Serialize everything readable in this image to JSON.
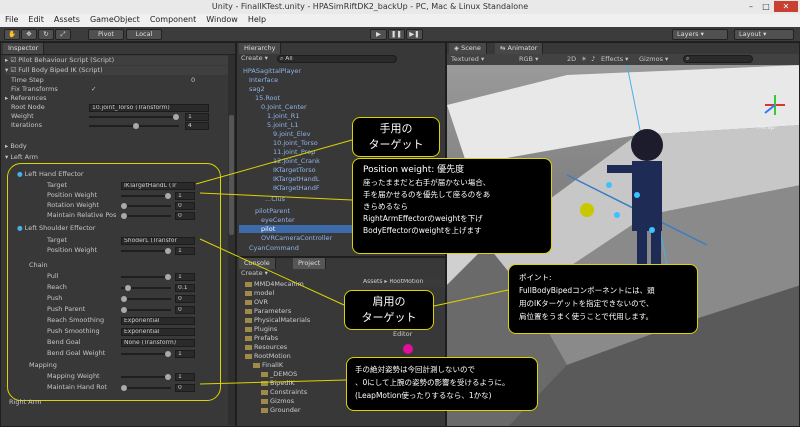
{
  "window": {
    "title": "Unity - FinalIKTest.unity - HPASimRiftDK2_backUp - PC, Mac & Linux Standalone"
  },
  "menu": [
    "File",
    "Edit",
    "Assets",
    "GameObject",
    "Component",
    "Window",
    "Help"
  ],
  "toolbar": {
    "pivot": "Pivot",
    "local": "Local",
    "layers": "Layers",
    "layout": "Layout"
  },
  "inspector": {
    "tab": "Inspector",
    "components": [
      "Pilot Behaviour Script (Script)",
      "Full Body Biped IK (Script)"
    ],
    "rows": [
      {
        "label": "Time Step",
        "value": "0"
      },
      {
        "label": "Fix Transforms",
        "value": "✓"
      },
      {
        "label": "References",
        "value": ""
      },
      {
        "label": "Root Node",
        "value": "10.joint_Torso (Transform)"
      },
      {
        "label": "Weight",
        "value": "1"
      },
      {
        "label": "Iterations",
        "value": "4"
      },
      {
        "label": "Body",
        "value": ""
      },
      {
        "label": "Left Arm",
        "value": ""
      }
    ],
    "left_hand_effector": {
      "title": "Left Hand Effector",
      "rows": [
        {
          "label": "Target",
          "value": "IKTargetHandL (Tr"
        },
        {
          "label": "Position Weight",
          "value": "1"
        },
        {
          "label": "Rotation Weight",
          "value": "0"
        },
        {
          "label": "Maintain Relative Pos",
          "value": "0"
        }
      ]
    },
    "left_shoulder_effector": {
      "title": "Left Shoulder Effector",
      "rows": [
        {
          "label": "Target",
          "value": "ShoderL (Transfor"
        },
        {
          "label": "Position Weight",
          "value": "1"
        }
      ]
    },
    "chain": {
      "title": "Chain",
      "rows": [
        {
          "label": "Pull",
          "value": "1"
        },
        {
          "label": "Reach",
          "value": "0.1"
        },
        {
          "label": "Push",
          "value": "0"
        },
        {
          "label": "Push Parent",
          "value": "0"
        },
        {
          "label": "Reach Smoothing",
          "value": "Exponential"
        },
        {
          "label": "Push Smoothing",
          "value": "Exponential"
        },
        {
          "label": "Bend Goal",
          "value": "None (Transform)"
        },
        {
          "label": "Bend Goal Weight",
          "value": "1"
        }
      ]
    },
    "mapping": {
      "title": "Mapping",
      "rows": [
        {
          "label": "Mapping Weight",
          "value": "1"
        },
        {
          "label": "Maintain Hand Rot",
          "value": "0"
        }
      ]
    },
    "right_arm": "Right Arm"
  },
  "hierarchy": {
    "tab": "Hierarchy",
    "create": "Create",
    "search": "All",
    "items": [
      "HPASagittalPlayer",
      "Interface",
      "sag2",
      "15.Root",
      "0.Joint_Center",
      "1.joint_R1",
      "5.joint_L1",
      "9.joint_Elev",
      "10.joint_Torso",
      "11.joint_Prop",
      "12.joint_Crank",
      "IKTargetTorso",
      "IKTargetHandL",
      "IKTargetHandF",
      "...Clus",
      "pilotParent",
      "eyeCenter",
      "pilot",
      "OVRCameraController",
      "CyanCommand"
    ]
  },
  "project": {
    "tabs": [
      "Console",
      "Project"
    ],
    "create": "Create",
    "items": [
      "MMD4Mecanim",
      "model",
      "OVR",
      "Parameters",
      "PhysicalMaterials",
      "Plugins",
      "Prefabs",
      "Resources",
      "RootMotion",
      "FinalIK",
      "_DEMOS",
      "BipedIK",
      "Constraints",
      "Gizmos",
      "Grounder"
    ],
    "breadcrumb": "Assets ▸ RootMotion",
    "editor_label": "Editor"
  },
  "scene": {
    "tabs": [
      "Scene",
      "Animator"
    ],
    "textured": "Textured",
    "rgb": "RGB",
    "mode_2d": "2D",
    "effects": "Effects",
    "gizmos": "Gizmos",
    "persp": "Persp"
  },
  "callouts": {
    "hand_target": [
      "手用の",
      "ターゲット"
    ],
    "position_weight": [
      "Position weight: 優先度",
      "座ったままだと右手が届かない場合、",
      "手を届かせるのを優先して座るのをあ",
      "きらめるなら",
      "RightArmEffectorのweightを下げ",
      "BodyEffectorのweightを上げます"
    ],
    "point": [
      "ポイント:",
      "FullBodyBipedコンポーネントには、頭",
      "用のIKターゲットを指定できないので、",
      "肩位置をうまく使うことで代用します。"
    ],
    "shoulder_target": [
      "肩用の",
      "ターゲット"
    ],
    "hand_rotation": [
      "手の絶対姿勢は今回計測しないので",
      "、0にして上腕の姿勢の影響を受けるように。",
      "(LeapMotion使ったりするなら、1かな)"
    ]
  }
}
